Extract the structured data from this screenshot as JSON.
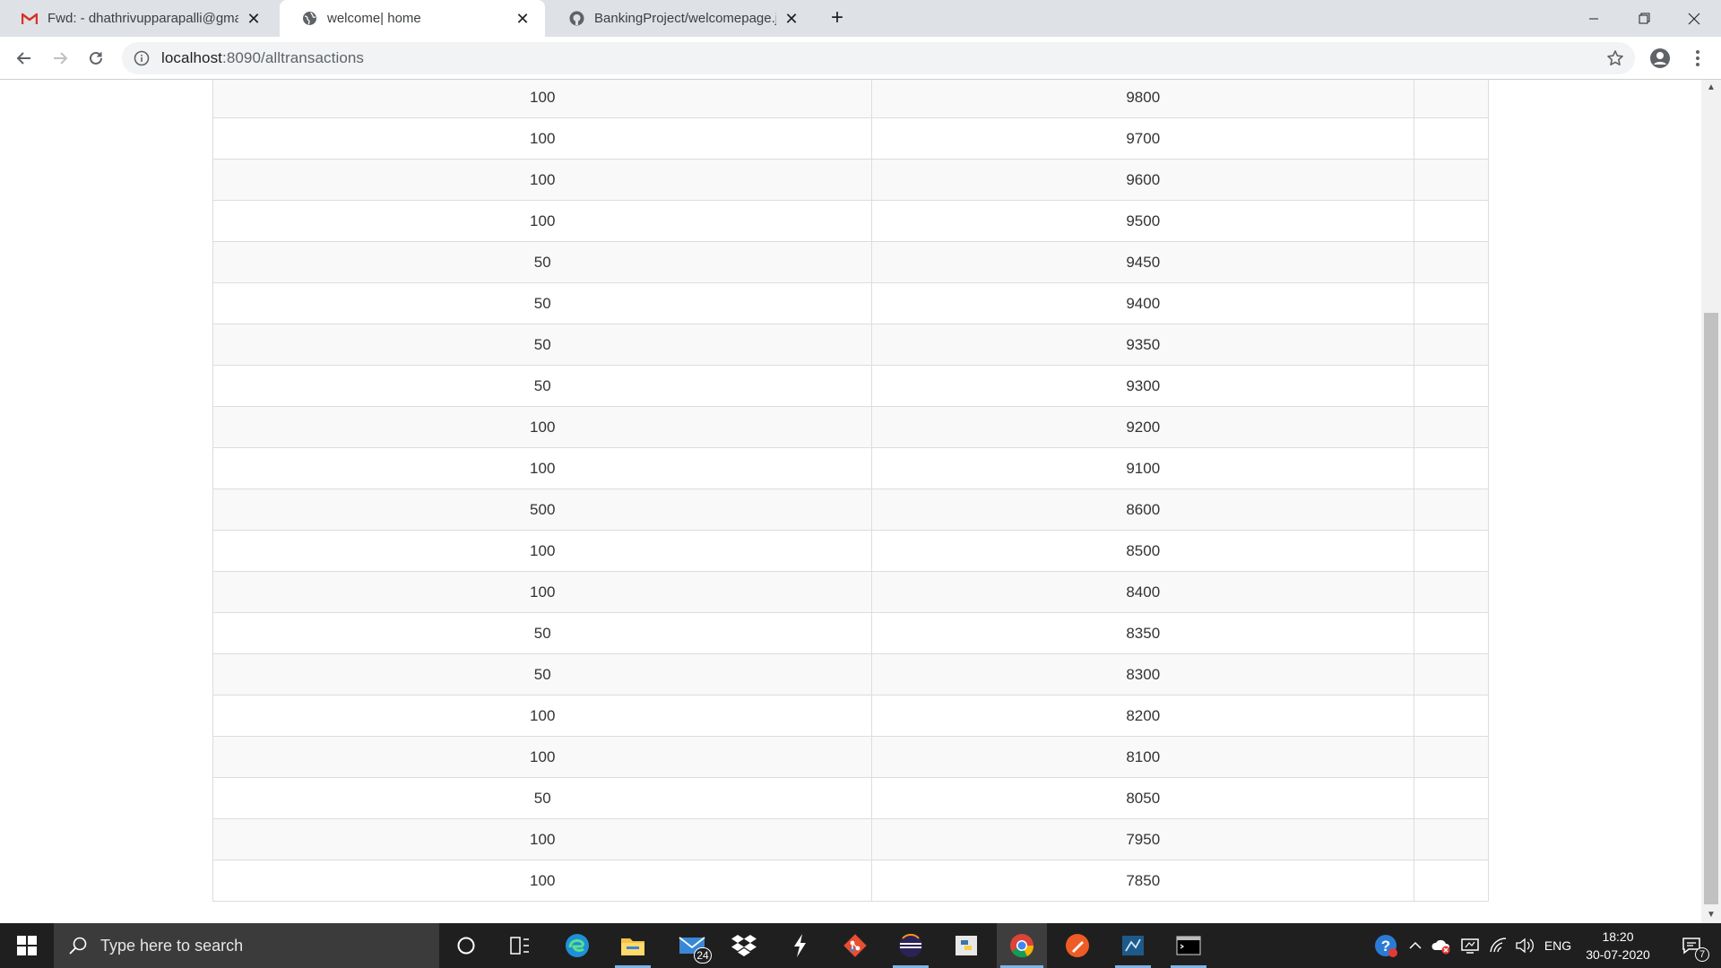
{
  "browser": {
    "tabs": [
      {
        "title": "Fwd: - dhathrivupparapalli@gma",
        "icon": "gmail-icon",
        "active": false
      },
      {
        "title": "welcome| home",
        "icon": "globe-icon",
        "active": true
      },
      {
        "title": "BankingProject/welcomepage.jsp",
        "icon": "github-icon",
        "active": false
      }
    ],
    "new_tab_label": "+",
    "url_host": "localhost",
    "url_path": ":8090/alltransactions"
  },
  "transactions": {
    "rows": [
      {
        "amount": "100",
        "balance": "9800"
      },
      {
        "amount": "100",
        "balance": "9700"
      },
      {
        "amount": "100",
        "balance": "9600"
      },
      {
        "amount": "100",
        "balance": "9500"
      },
      {
        "amount": "50",
        "balance": "9450"
      },
      {
        "amount": "50",
        "balance": "9400"
      },
      {
        "amount": "50",
        "balance": "9350"
      },
      {
        "amount": "50",
        "balance": "9300"
      },
      {
        "amount": "100",
        "balance": "9200"
      },
      {
        "amount": "100",
        "balance": "9100"
      },
      {
        "amount": "500",
        "balance": "8600"
      },
      {
        "amount": "100",
        "balance": "8500"
      },
      {
        "amount": "100",
        "balance": "8400"
      },
      {
        "amount": "50",
        "balance": "8350"
      },
      {
        "amount": "50",
        "balance": "8300"
      },
      {
        "amount": "100",
        "balance": "8200"
      },
      {
        "amount": "100",
        "balance": "8100"
      },
      {
        "amount": "50",
        "balance": "8050"
      },
      {
        "amount": "100",
        "balance": "7950"
      },
      {
        "amount": "100",
        "balance": "7850"
      }
    ]
  },
  "taskbar": {
    "search_placeholder": "Type here to search",
    "mail_badge": "24",
    "language": "ENG",
    "time": "18:20",
    "date": "30-07-2020",
    "notification_count": "7",
    "accent_color": "#7fb4e8"
  }
}
